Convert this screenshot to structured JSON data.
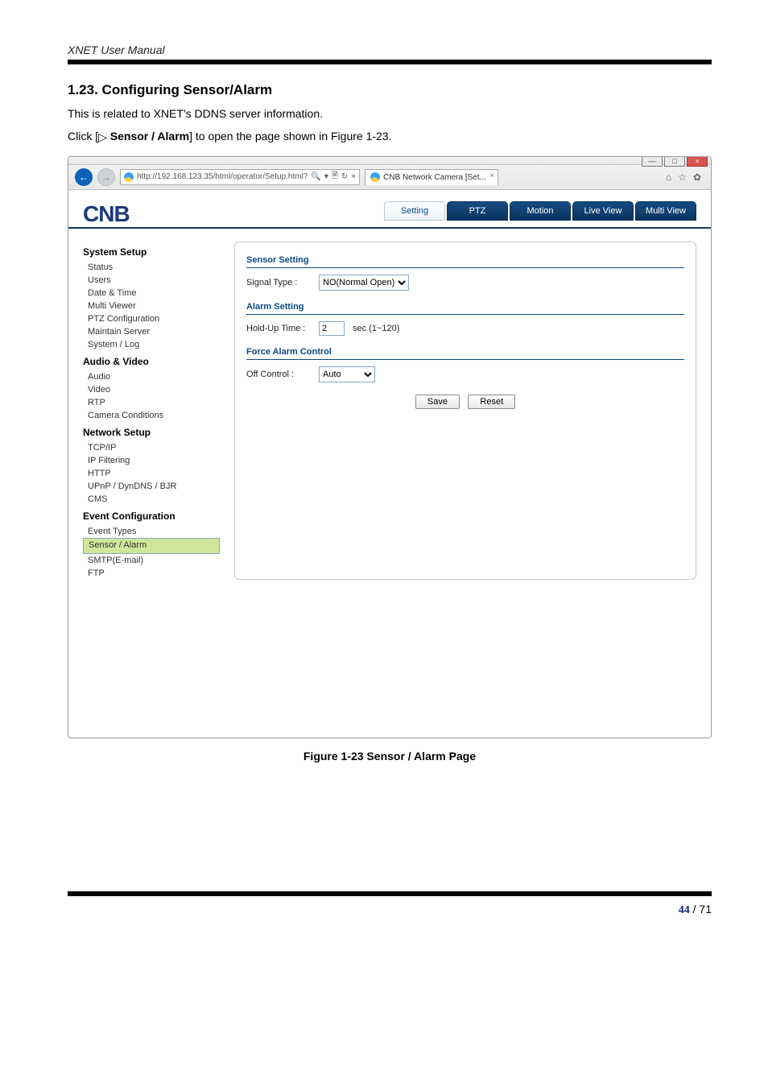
{
  "doc": {
    "header": "XNET User Manual",
    "section_no": "1.23.",
    "section_title": "Configuring Sensor/Alarm",
    "intro": "This is related to XNET's DDNS server information.",
    "click_pre": "Click [",
    "click_tri": "▷",
    "click_item": " Sensor / Alarm",
    "click_post": "] to open the page shown in Figure 1-23.",
    "figure_caption": "Figure 1-23 Sensor / Alarm Page",
    "page_cur": "44",
    "page_sep": " / ",
    "page_total": "71"
  },
  "win": {
    "btn_min": "—",
    "btn_max": "□",
    "btn_close": "×"
  },
  "addr": {
    "url_display": "http://192.168.123.35/html/operator/Setup.html?",
    "search_hint": "🔍",
    "refresh": "↻",
    "stop": "×",
    "tab_title": "CNB Network Camera [Set...",
    "home": "⌂",
    "star": "☆",
    "gear": "✿"
  },
  "page": {
    "logo": "CNB",
    "tabs": {
      "setting": "Setting",
      "ptz": "PTZ",
      "motion": "Motion",
      "live": "Live View",
      "multi": "Multi View"
    }
  },
  "sidebar": {
    "g1": {
      "title": "System Setup",
      "items": [
        "Status",
        "Users",
        "Date & Time",
        "Multi Viewer",
        "PTZ Configuration",
        "Maintain Server",
        "System / Log"
      ]
    },
    "g2": {
      "title": "Audio & Video",
      "items": [
        "Audio",
        "Video",
        "RTP",
        "Camera Conditions"
      ]
    },
    "g3": {
      "title": "Network Setup",
      "items": [
        "TCP/IP",
        "IP Filtering",
        "HTTP",
        "UPnP / DynDNS / BJR",
        "CMS"
      ]
    },
    "g4": {
      "title": "Event Configuration",
      "items": [
        "Event Types",
        "Sensor / Alarm",
        "SMTP(E-mail)",
        "FTP"
      ],
      "selected_index": 1
    }
  },
  "form": {
    "sensor": {
      "heading": "Sensor Setting",
      "signal_label": "Signal Type :",
      "signal_value": "NO(Normal Open)"
    },
    "alarm": {
      "heading": "Alarm Setting",
      "hold_label": "Hold-Up Time :",
      "hold_value": "2",
      "hold_hint": "sec (1~120)"
    },
    "force": {
      "heading": "Force Alarm Control",
      "off_label": "Off Control :",
      "off_value": "Auto"
    },
    "buttons": {
      "save": "Save",
      "reset": "Reset"
    }
  }
}
